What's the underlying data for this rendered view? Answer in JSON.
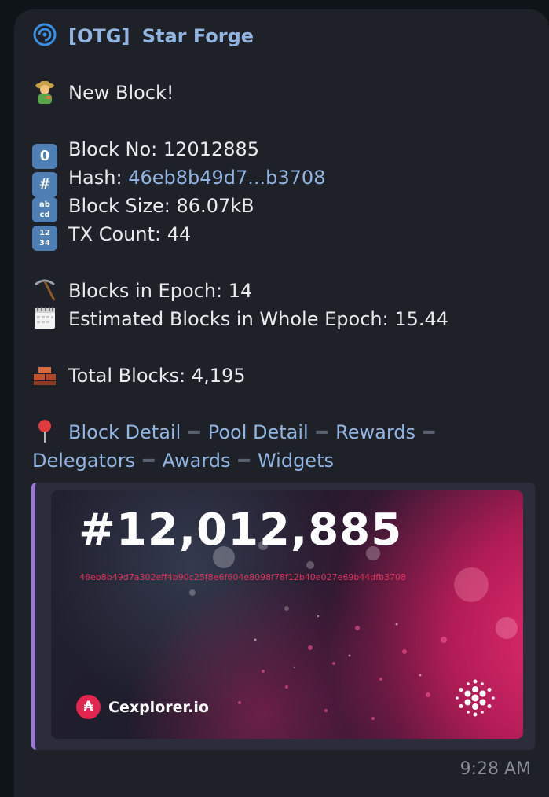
{
  "header": {
    "tag": "[OTG]",
    "name": "Star Forge"
  },
  "message": {
    "title": "New Block!",
    "block_no": "Block No: 12012885",
    "hash_label": "Hash: ",
    "hash_value": "46eb8b49d7...b3708",
    "block_size": "Block Size: 86.07kB",
    "tx_count": "TX Count: 44",
    "blocks_in_epoch": "Blocks in Epoch: 14",
    "estimated_blocks": "Estimated Blocks in Whole Epoch: 15.44",
    "total_blocks": "Total Blocks: 4,195"
  },
  "links": {
    "block_detail": "Block Detail",
    "pool_detail": "Pool Detail",
    "rewards": "Rewards",
    "delegators": "Delegators",
    "awards": "Awards",
    "widgets": "Widgets",
    "separator": "━"
  },
  "card": {
    "number": "#12,012,885",
    "hash": "46eb8b49d7a302eff4b90c25f8e6f604e8098f78f12b40e027e69b44dfb3708",
    "brand": "Cexplorer.io",
    "ada_symbol": "₳"
  },
  "timestamp": "9:28 AM",
  "icons": {
    "zero": "0",
    "hash": "#",
    "abcd": "ab cd",
    "numbers": "12 34"
  },
  "colors": {
    "link": "#92b4e0",
    "hash_red": "#e0345c",
    "accent_bar": "#9b78d6"
  }
}
